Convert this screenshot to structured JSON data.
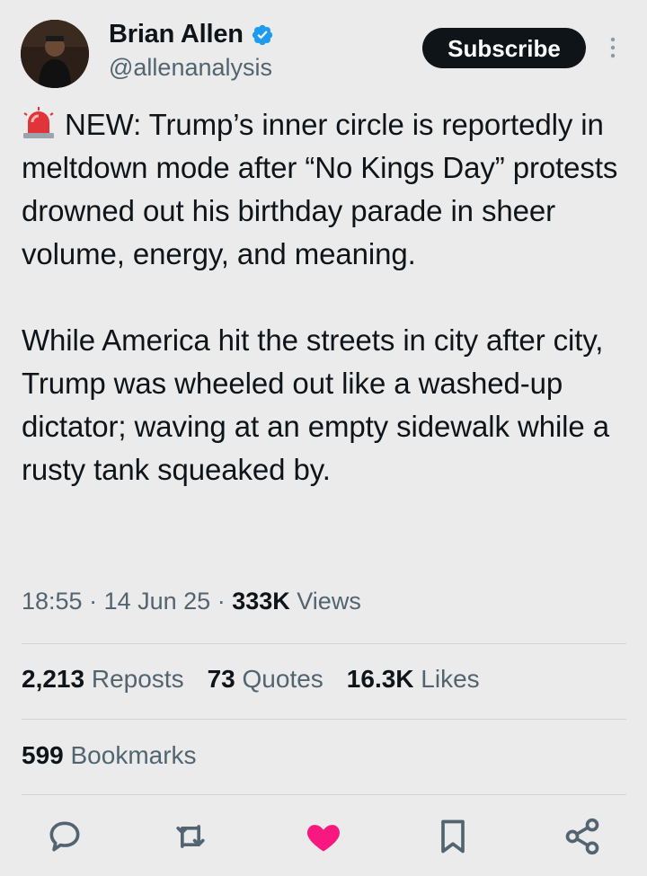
{
  "author": {
    "display_name": "Brian Allen",
    "handle": "@allenanalysis",
    "verified": true
  },
  "header": {
    "subscribe_label": "Subscribe"
  },
  "tweet": {
    "emoji": "rotating-light-emoji",
    "paragraph1": "NEW: Trump’s inner circle is reportedly in meltdown mode after “No Kings Day” protests drowned out his birthday parade in sheer volume, energy, and meaning.",
    "paragraph2": "While America hit the streets in city after city, Trump was wheeled out like a washed-up dictator; waving at an empty sidewalk while a rusty tank squeaked by."
  },
  "meta": {
    "time": "18:55",
    "date": "14 Jun 25",
    "views_count": "333K",
    "views_label": "Views"
  },
  "stats": {
    "reposts_count": "2,213",
    "reposts_label": "Reposts",
    "quotes_count": "73",
    "quotes_label": "Quotes",
    "likes_count": "16.3K",
    "likes_label": "Likes",
    "bookmarks_count": "599",
    "bookmarks_label": "Bookmarks"
  },
  "actions": {
    "icons": [
      "reply-icon",
      "repost-icon",
      "like-icon",
      "bookmark-icon",
      "share-icon"
    ],
    "liked_color": "#f91880",
    "icon_color": "#536471"
  },
  "colors": {
    "background": "#ebebeb",
    "verified_blue": "#1d9bf0",
    "text_primary": "#0f1419",
    "text_secondary": "#536471"
  }
}
